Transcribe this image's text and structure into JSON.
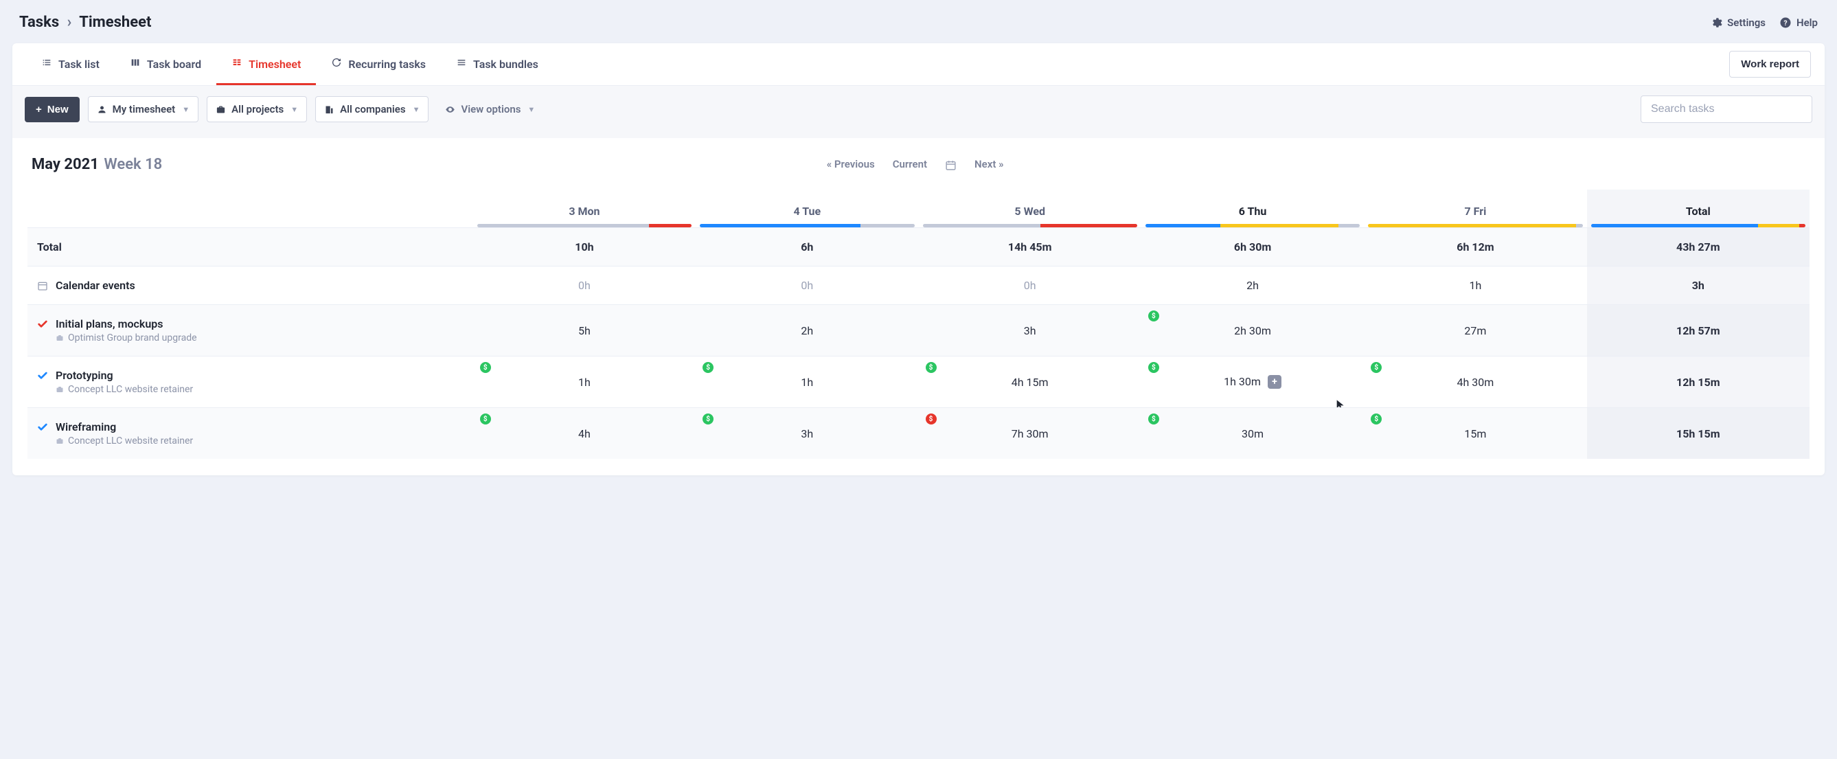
{
  "breadcrumb": {
    "root": "Tasks",
    "current": "Timesheet"
  },
  "header_links": {
    "settings": "Settings",
    "help": "Help"
  },
  "tabs": [
    {
      "id": "task-list",
      "label": "Task list"
    },
    {
      "id": "task-board",
      "label": "Task board"
    },
    {
      "id": "timesheet",
      "label": "Timesheet"
    },
    {
      "id": "recurring",
      "label": "Recurring tasks"
    },
    {
      "id": "bundles",
      "label": "Task bundles"
    }
  ],
  "active_tab": "timesheet",
  "work_report_btn": "Work report",
  "filters": {
    "new_btn": "New",
    "timesheet_scope": "My timesheet",
    "projects": "All projects",
    "companies": "All companies",
    "view_options": "View options"
  },
  "search_placeholder": "Search tasks",
  "period": {
    "month_year": "May 2021",
    "week_label": "Week 18"
  },
  "nav": {
    "prev": "« Previous",
    "current": "Current",
    "next": "Next »"
  },
  "columns": [
    {
      "id": "mon",
      "label": "3 Mon",
      "today": false,
      "bar": [
        [
          "grey",
          0.8
        ],
        [
          "red",
          0.2
        ]
      ]
    },
    {
      "id": "tue",
      "label": "4 Tue",
      "today": false,
      "bar": [
        [
          "blue",
          0.75
        ],
        [
          "grey",
          0.25
        ]
      ]
    },
    {
      "id": "wed",
      "label": "5 Wed",
      "today": false,
      "bar": [
        [
          "grey",
          0.55
        ],
        [
          "red",
          0.45
        ]
      ]
    },
    {
      "id": "thu",
      "label": "6 Thu",
      "today": true,
      "bar": [
        [
          "blue",
          0.35
        ],
        [
          "yellow",
          0.55
        ],
        [
          "grey",
          0.1
        ]
      ]
    },
    {
      "id": "fri",
      "label": "7 Fri",
      "today": false,
      "bar": [
        [
          "yellow",
          0.97
        ],
        [
          "grey",
          0.03
        ]
      ]
    }
  ],
  "total_col": {
    "label": "Total",
    "bar": [
      [
        "blue",
        0.78
      ],
      [
        "yellow",
        0.19
      ],
      [
        "red",
        0.03
      ]
    ]
  },
  "totals_row": {
    "label": "Total",
    "cells": [
      "10h",
      "6h",
      "14h 45m",
      "6h 30m",
      "6h 12m"
    ],
    "total": "43h 27m"
  },
  "rows": [
    {
      "icon": "calendar",
      "title": "Calendar events",
      "sub": null,
      "cells": [
        "0h",
        "0h",
        "0h",
        "2h",
        "1h"
      ],
      "muted": [
        true,
        true,
        true,
        false,
        false
      ],
      "badges": [
        null,
        null,
        null,
        null,
        null
      ],
      "total": "3h",
      "alt": false
    },
    {
      "icon": "check-red",
      "title": "Initial plans, mockups",
      "sub": "Optimist Group brand upgrade",
      "cells": [
        "5h",
        "2h",
        "3h",
        "2h 30m",
        "27m"
      ],
      "muted": [
        false,
        false,
        false,
        false,
        false
      ],
      "badges": [
        null,
        null,
        null,
        "green",
        null
      ],
      "total": "12h 57m",
      "alt": true
    },
    {
      "icon": "check-blue",
      "title": "Prototyping",
      "sub": "Concept LLC website retainer",
      "cells": [
        "1h",
        "1h",
        "4h 15m",
        "1h 30m",
        "4h 30m"
      ],
      "muted": [
        false,
        false,
        false,
        false,
        false
      ],
      "badges": [
        "green",
        "green",
        "green",
        "green",
        "green"
      ],
      "total": "12h 15m",
      "alt": false,
      "hover_add_at": 3
    },
    {
      "icon": "check-blue",
      "title": "Wireframing",
      "sub": "Concept LLC website retainer",
      "cells": [
        "4h",
        "3h",
        "7h 30m",
        "30m",
        "15m"
      ],
      "muted": [
        false,
        false,
        false,
        false,
        false
      ],
      "badges": [
        "green",
        "green",
        "red",
        "green",
        "green"
      ],
      "total": "15h 15m",
      "alt": true
    }
  ]
}
